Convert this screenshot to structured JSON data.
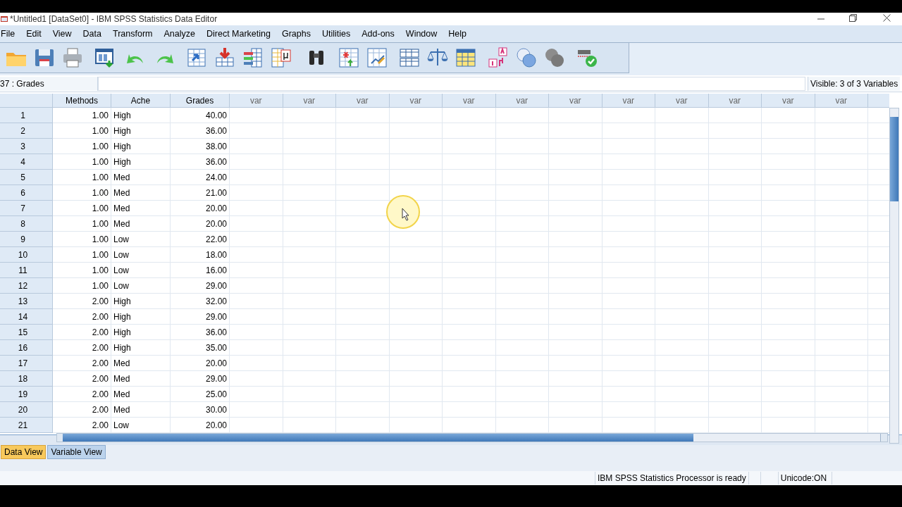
{
  "window": {
    "title": "*Untitled1 [DataSet0] - IBM SPSS Statistics Data Editor"
  },
  "menu": [
    "File",
    "Edit",
    "View",
    "Data",
    "Transform",
    "Analyze",
    "Direct Marketing",
    "Graphs",
    "Utilities",
    "Add-ons",
    "Window",
    "Help"
  ],
  "cell_editor": {
    "reference": "37 : Grades"
  },
  "visible_label": "Visible: 3 of 3 Variables",
  "table": {
    "columns": [
      {
        "label": "Methods",
        "kind": "numeric"
      },
      {
        "label": "Ache",
        "kind": "string"
      },
      {
        "label": "Grades",
        "kind": "numeric"
      },
      {
        "label": "var",
        "kind": "empty"
      },
      {
        "label": "var",
        "kind": "empty"
      },
      {
        "label": "var",
        "kind": "empty"
      },
      {
        "label": "var",
        "kind": "empty"
      },
      {
        "label": "var",
        "kind": "empty"
      },
      {
        "label": "var",
        "kind": "empty"
      },
      {
        "label": "var",
        "kind": "empty"
      },
      {
        "label": "var",
        "kind": "empty"
      },
      {
        "label": "var",
        "kind": "empty"
      },
      {
        "label": "var",
        "kind": "empty"
      },
      {
        "label": "var",
        "kind": "empty"
      },
      {
        "label": "var",
        "kind": "empty"
      }
    ],
    "rows": [
      {
        "number": "1",
        "cells": [
          "1.00",
          "High",
          "40.00"
        ]
      },
      {
        "number": "2",
        "cells": [
          "1.00",
          "High",
          "36.00"
        ]
      },
      {
        "number": "3",
        "cells": [
          "1.00",
          "High",
          "38.00"
        ]
      },
      {
        "number": "4",
        "cells": [
          "1.00",
          "High",
          "36.00"
        ]
      },
      {
        "number": "5",
        "cells": [
          "1.00",
          "Med",
          "24.00"
        ]
      },
      {
        "number": "6",
        "cells": [
          "1.00",
          "Med",
          "21.00"
        ]
      },
      {
        "number": "7",
        "cells": [
          "1.00",
          "Med",
          "20.00"
        ]
      },
      {
        "number": "8",
        "cells": [
          "1.00",
          "Med",
          "20.00"
        ]
      },
      {
        "number": "9",
        "cells": [
          "1.00",
          "Low",
          "22.00"
        ]
      },
      {
        "number": "10",
        "cells": [
          "1.00",
          "Low",
          "18.00"
        ]
      },
      {
        "number": "11",
        "cells": [
          "1.00",
          "Low",
          "16.00"
        ]
      },
      {
        "number": "12",
        "cells": [
          "1.00",
          "Low",
          "29.00"
        ]
      },
      {
        "number": "13",
        "cells": [
          "2.00",
          "High",
          "32.00"
        ]
      },
      {
        "number": "14",
        "cells": [
          "2.00",
          "High",
          "29.00"
        ]
      },
      {
        "number": "15",
        "cells": [
          "2.00",
          "High",
          "36.00"
        ]
      },
      {
        "number": "16",
        "cells": [
          "2.00",
          "High",
          "35.00"
        ]
      },
      {
        "number": "17",
        "cells": [
          "2.00",
          "Med",
          "20.00"
        ]
      },
      {
        "number": "18",
        "cells": [
          "2.00",
          "Med",
          "29.00"
        ]
      },
      {
        "number": "19",
        "cells": [
          "2.00",
          "Med",
          "25.00"
        ]
      },
      {
        "number": "20",
        "cells": [
          "2.00",
          "Med",
          "30.00"
        ]
      },
      {
        "number": "21",
        "cells": [
          "2.00",
          "Low",
          "20.00"
        ]
      }
    ]
  },
  "tabs": [
    {
      "label": "Data View",
      "selected": true
    },
    {
      "label": "Variable View",
      "selected": false
    }
  ],
  "status_bar": {
    "processor": "IBM SPSS Statistics Processor is ready",
    "unicode": "Unicode:ON"
  }
}
